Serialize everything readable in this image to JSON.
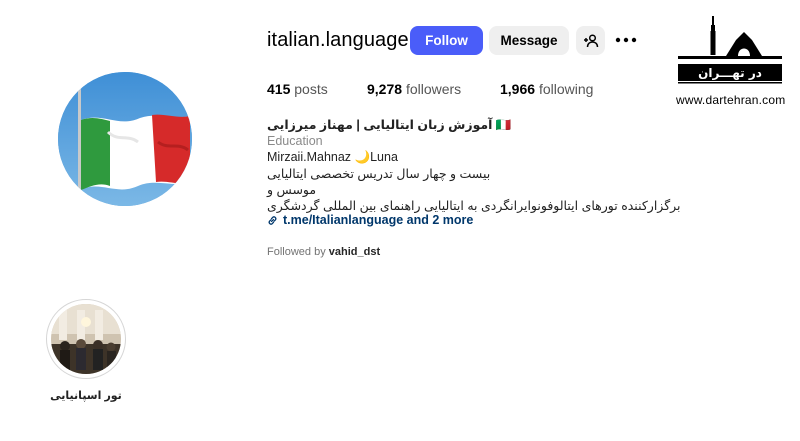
{
  "profile": {
    "username": "italian.language",
    "follow_label": "Follow",
    "message_label": "Message"
  },
  "stats": {
    "posts_count": "415",
    "posts_label": "posts",
    "followers_count": "9,278",
    "followers_label": "followers",
    "following_count": "1,966",
    "following_label": "following"
  },
  "bio": {
    "name": "آموزش زبان ایتالیایی | مهناز میرزایی 🇮🇹",
    "category": "Education",
    "line1": "Mirzaii.Mahnaz 🌙Luna",
    "line2": "بیست و چهار سال تدریس تخصصی ایتالیایی",
    "line3": "موسس و",
    "line4": "برگزارکننده تورهای ایتالوفونوایرانگردی به ایتالیایی راهنمای بین المللی گردشگری",
    "link": "t.me/Italianlanguage and 2 more",
    "followed_prefix": "Followed by ",
    "followed_user": "vahid_dst"
  },
  "highlights": [
    {
      "label": "تور اسپانیایی"
    }
  ],
  "watermark": {
    "logo_text": "در تهـــران",
    "url": "www.dartehran.com"
  },
  "colors": {
    "accent": "#4a5df9",
    "button_gray": "#efefef",
    "link": "#00376b",
    "muted": "#737373"
  }
}
